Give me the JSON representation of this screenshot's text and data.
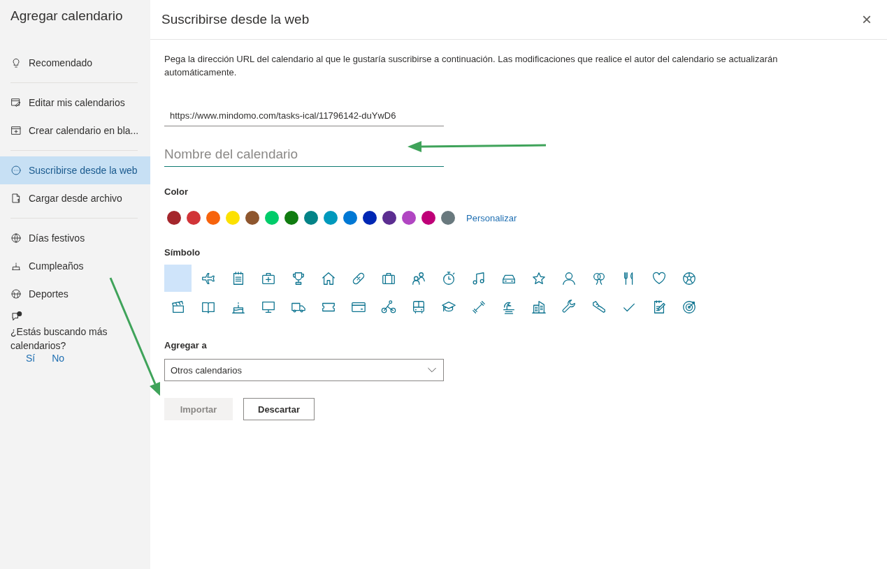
{
  "sidebar": {
    "title": "Agregar calendario",
    "groups": [
      [
        {
          "label": "Recomendado",
          "selected": false
        }
      ],
      [
        {
          "label": "Editar mis calendarios",
          "selected": false
        },
        {
          "label": "Crear calendario en bla...",
          "selected": false
        }
      ],
      [
        {
          "label": "Suscribirse desde la web",
          "selected": true
        },
        {
          "label": "Cargar desde archivo",
          "selected": false
        }
      ],
      [
        {
          "label": "Días festivos",
          "selected": false
        },
        {
          "label": "Cumpleaños",
          "selected": false
        },
        {
          "label": "Deportes",
          "selected": false
        }
      ]
    ],
    "feedback": {
      "question": "¿Estás buscando más calendarios?",
      "yes": "Sí",
      "no": "No"
    }
  },
  "dialog": {
    "title": "Suscribirse desde la web",
    "close": "×",
    "description": "Pega la dirección URL del calendario al que le gustaría suscribirse a continuación. Las modificaciones que realice el autor del calendario se actualizarán automáticamente.",
    "url": {
      "value": "https://www.mindomo.com/tasks-ical/11796142-duYwD6"
    },
    "name": {
      "placeholder": "Nombre del calendario"
    },
    "color_label": "Color",
    "colors": [
      {
        "color": "#a4262c",
        "selected": false
      },
      {
        "color": "#d13438",
        "selected": false
      },
      {
        "color": "#f7630c",
        "selected": false
      },
      {
        "color": "#fce100",
        "selected": false
      },
      {
        "color": "#8e562e",
        "selected": false
      },
      {
        "color": "#00cc6a",
        "selected": false
      },
      {
        "color": "#107c10",
        "selected": false
      },
      {
        "color": "#038387",
        "selected": false
      },
      {
        "color": "#0099bc",
        "selected": false
      },
      {
        "color": "#0078d4",
        "selected": false
      },
      {
        "color": "#0027b4",
        "selected": false
      },
      {
        "color": "#5c2e91",
        "selected": false
      },
      {
        "color": "#b146c2",
        "selected": false
      },
      {
        "color": "#bf0077",
        "selected": false
      },
      {
        "color": "#69797e",
        "selected": false
      }
    ],
    "custom_color": "Personalizar",
    "symbol_label": "Símbolo",
    "symbols": [
      {
        "selected": true
      },
      {
        "selected": false
      },
      {
        "selected": false
      },
      {
        "selected": false
      },
      {
        "selected": false
      },
      {
        "selected": false
      },
      {
        "selected": false
      },
      {
        "selected": false
      },
      {
        "selected": false
      },
      {
        "selected": false
      },
      {
        "selected": false
      },
      {
        "selected": false
      },
      {
        "selected": false
      },
      {
        "selected": false
      },
      {
        "selected": false
      },
      {
        "selected": false
      },
      {
        "selected": false
      },
      {
        "selected": false
      },
      {
        "selected": false
      },
      {
        "selected": false
      },
      {
        "selected": false
      },
      {
        "selected": false
      },
      {
        "selected": false
      },
      {
        "selected": false
      },
      {
        "selected": false
      },
      {
        "selected": false
      },
      {
        "selected": false
      },
      {
        "selected": false
      },
      {
        "selected": false
      },
      {
        "selected": false
      },
      {
        "selected": false
      },
      {
        "selected": false
      },
      {
        "selected": false
      },
      {
        "selected": false
      },
      {
        "selected": false
      },
      {
        "selected": false
      }
    ],
    "add_to_label": "Agregar a",
    "add_to": {
      "value": "Otros calendarios"
    },
    "import": {
      "label": "Importar",
      "disabled": true
    },
    "discard": {
      "label": "Descartar",
      "disabled": false
    }
  }
}
